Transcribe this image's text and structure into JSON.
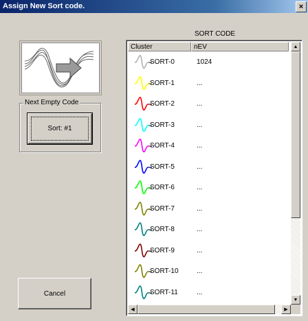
{
  "window": {
    "title": "Assign New Sort code.",
    "close_glyph": "×"
  },
  "group": {
    "label": "Next Empty Code"
  },
  "buttons": {
    "sort_label": "Sort: #1",
    "cancel_label": "Cancel"
  },
  "list": {
    "header": "SORT CODE",
    "columns": [
      "Cluster",
      "nEV"
    ],
    "rows": [
      {
        "name": "SORT-0",
        "nev": "1024",
        "color": "#b0b0b0"
      },
      {
        "name": "SORT-1",
        "nev": "...",
        "color": "#ffff00"
      },
      {
        "name": "SORT-2",
        "nev": "...",
        "color": "#ff0000"
      },
      {
        "name": "SORT-3",
        "nev": "...",
        "color": "#00ffff"
      },
      {
        "name": "SORT-4",
        "nev": "...",
        "color": "#ff00ff"
      },
      {
        "name": "SORT-5",
        "nev": "...",
        "color": "#0000ff"
      },
      {
        "name": "SORT-6",
        "nev": "...",
        "color": "#00ff00"
      },
      {
        "name": "SORT-7",
        "nev": "...",
        "color": "#808000"
      },
      {
        "name": "SORT-8",
        "nev": "...",
        "color": "#008080"
      },
      {
        "name": "SORT-9",
        "nev": "...",
        "color": "#800000"
      },
      {
        "name": "SORT-10",
        "nev": "...",
        "color": "#808000"
      },
      {
        "name": "SORT-11",
        "nev": "...",
        "color": "#008080"
      }
    ]
  },
  "icons": {
    "preview": "waveform-arrow-icon",
    "row": "spike-waveform-icon"
  }
}
